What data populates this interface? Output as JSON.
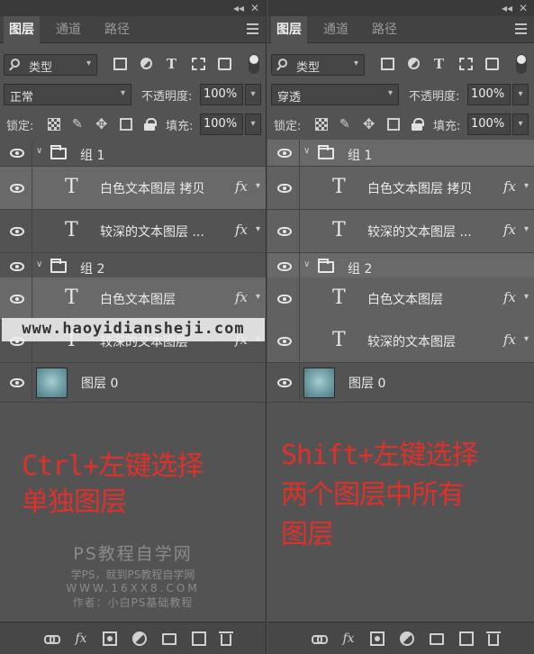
{
  "panels": [
    {
      "tabs": [
        "图层",
        "通道",
        "路径"
      ],
      "filter_kind": "类型",
      "blend_mode": "正常",
      "opacity_label": "不透明度:",
      "opacity": "100%",
      "lock_label": "锁定:",
      "fill_label": "填充:",
      "fill": "100%",
      "layers": [
        {
          "name": "组 1"
        },
        {
          "name": "白色文本图层 拷贝",
          "fx": "fx"
        },
        {
          "name": "较深的文本图层 ...",
          "fx": "fx"
        },
        {
          "name": "组 2"
        },
        {
          "name": "白色文本图层",
          "fx": "fx"
        },
        {
          "name": "较深的文本图层",
          "fx": "fx"
        },
        {
          "name": "图层 0"
        }
      ],
      "annotation": [
        "Ctrl+左键选择",
        "单独图层"
      ],
      "watermark": [
        "PS教程自学网",
        "学PS，就到PS教程自学网",
        "WWW.16XX8.COM",
        "作者：小白PS基础教程"
      ]
    },
    {
      "tabs": [
        "图层",
        "通道",
        "路径"
      ],
      "filter_kind": "类型",
      "blend_mode": "穿透",
      "opacity_label": "不透明度:",
      "opacity": "100%",
      "lock_label": "锁定:",
      "fill_label": "填充:",
      "fill": "100%",
      "layers": [
        {
          "name": "组 1"
        },
        {
          "name": "白色文本图层 拷贝",
          "fx": "fx"
        },
        {
          "name": "较深的文本图层 ...",
          "fx": "fx"
        },
        {
          "name": "组 2"
        },
        {
          "name": "白色文本图层",
          "fx": "fx"
        },
        {
          "name": "较深的文本图层",
          "fx": "fx"
        },
        {
          "name": "图层 0"
        }
      ],
      "annotation": [
        "Shift+左键选择",
        "两个图层中所有",
        "图层"
      ]
    }
  ],
  "site_banner": "www.haoyidiansheji.com",
  "colors": {
    "annotation": "#e0302a",
    "selected_row": "#696969",
    "panel_bg": "#535353"
  },
  "icons": {
    "filter_bar": [
      "image-filter-icon",
      "adjustment-filter-icon",
      "type-filter-icon",
      "shape-filter-icon",
      "smart-object-filter-icon"
    ],
    "lock_bar": [
      "lock-pixels-icon",
      "lock-image-icon",
      "lock-position-icon",
      "lock-artboard-icon",
      "lock-all-icon"
    ],
    "footer": [
      "link-layers-icon",
      "fx-icon",
      "layer-mask-icon",
      "adjustment-layer-icon",
      "new-group-icon",
      "new-layer-icon",
      "delete-layer-icon"
    ]
  }
}
